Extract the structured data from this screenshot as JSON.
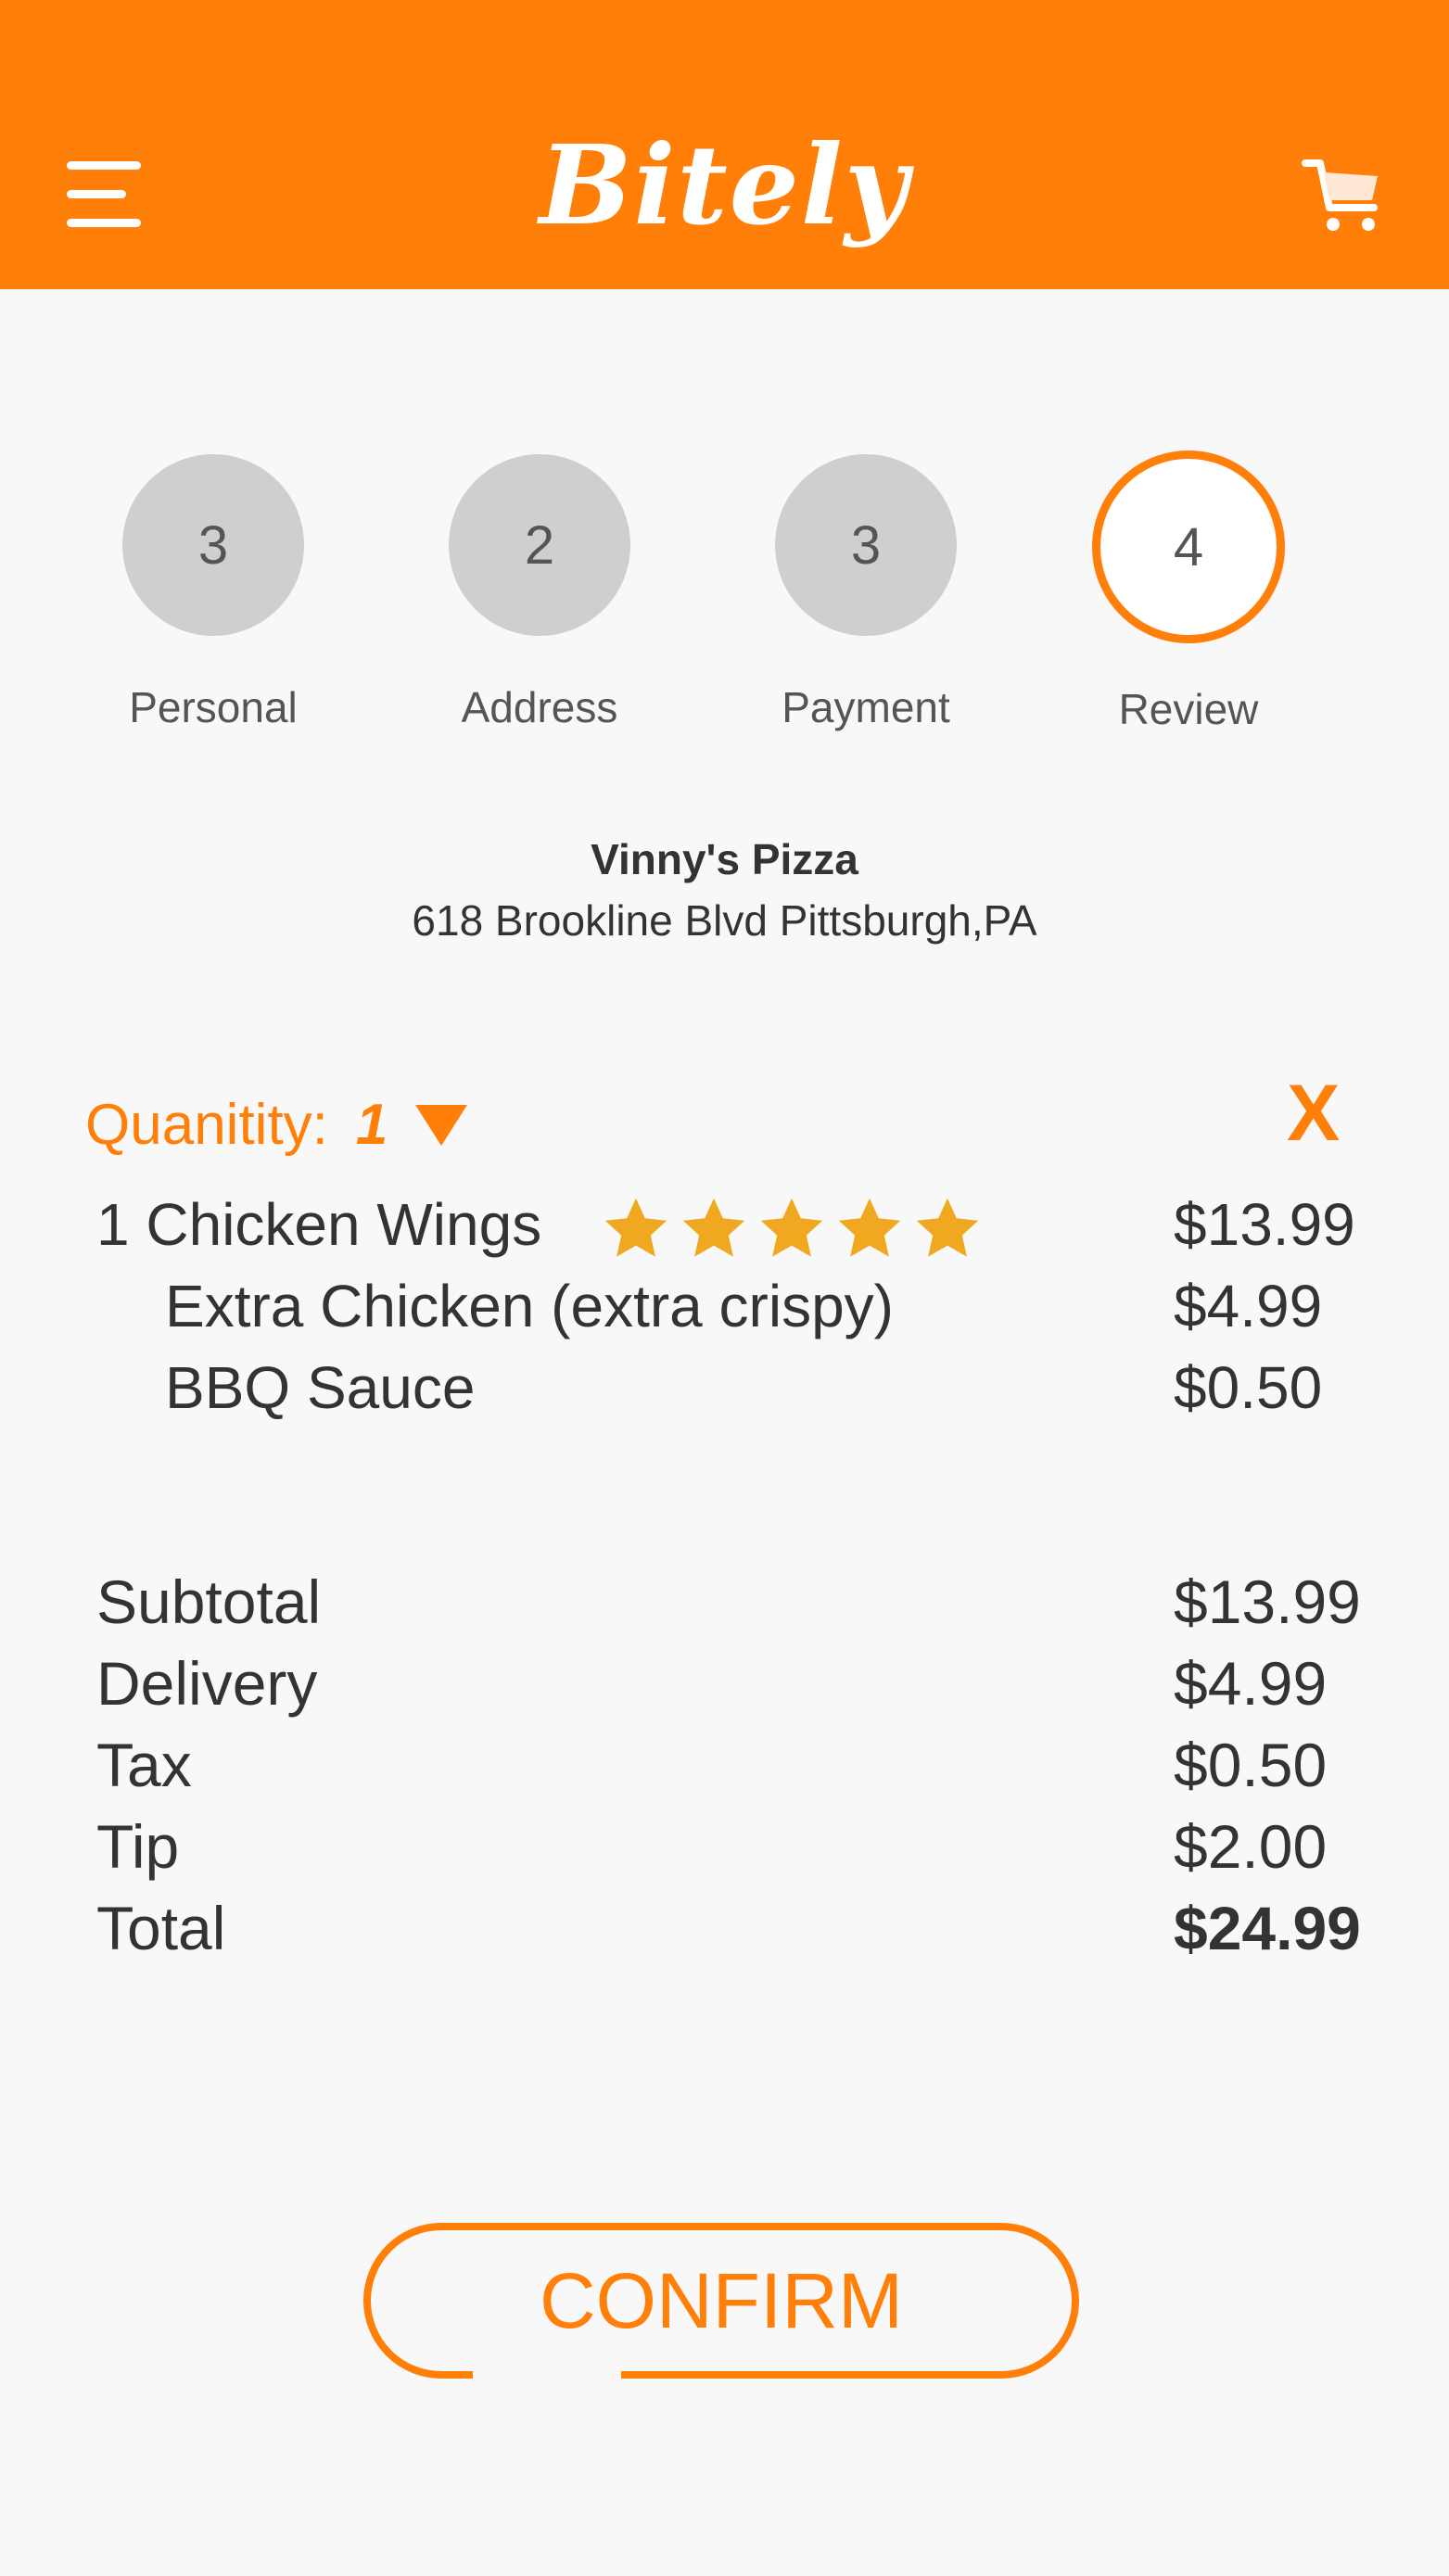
{
  "header": {
    "logo": "Bitely",
    "menu_icon": "hamburger-menu-icon",
    "cart_icon": "shopping-cart-icon",
    "background": "#ff7f08"
  },
  "steps": [
    {
      "number": "3",
      "label": "Personal",
      "active": false
    },
    {
      "number": "2",
      "label": "Address",
      "active": false
    },
    {
      "number": "3",
      "label": "Payment",
      "active": false
    },
    {
      "number": "4",
      "label": "Review",
      "active": true
    }
  ],
  "restaurant": {
    "name": "Vinny's Pizza",
    "address": "618 Brookline Blvd Pittsburgh,PA"
  },
  "order": {
    "quantity_label": "Quanitity:",
    "quantity_value": "1",
    "remove_label": "X",
    "item": {
      "name": "1 Chicken Wings",
      "price": "$13.99",
      "rating": 5,
      "rating_max": 5,
      "star_color": "#f0a820"
    },
    "addons": [
      {
        "name": "Extra Chicken (extra crispy)",
        "price": "$4.99"
      },
      {
        "name": "BBQ Sauce",
        "price": "$0.50"
      }
    ]
  },
  "totals": {
    "subtotal_label": "Subtotal",
    "subtotal": "$13.99",
    "delivery_label": "Delivery",
    "delivery": "$4.99",
    "tax_label": "Tax",
    "tax": "$0.50",
    "tip_label": "Tip",
    "tip": "$2.00",
    "total_label": "Total",
    "total": "$24.99"
  },
  "confirm_label": "CONFIRM",
  "accent_color": "#ff7f08"
}
